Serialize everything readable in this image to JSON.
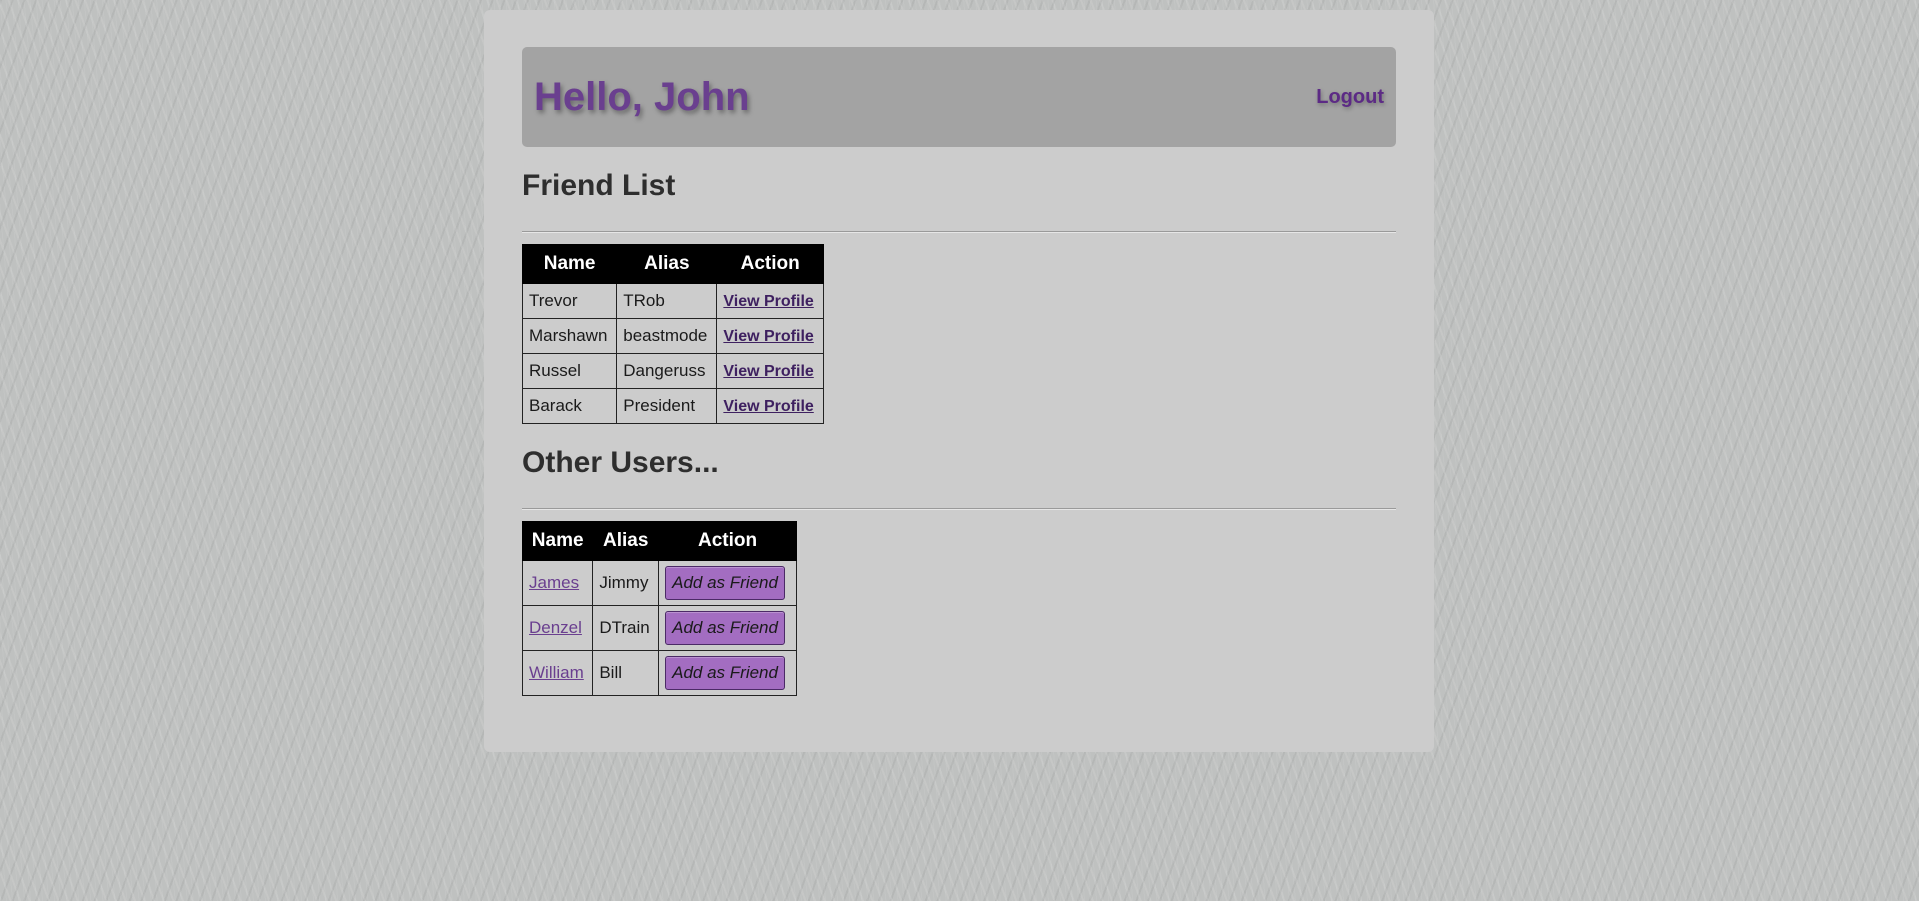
{
  "header": {
    "greeting": "Hello, John",
    "logout_label": "Logout"
  },
  "friends": {
    "title": "Friend List",
    "columns": [
      "Name",
      "Alias",
      "Action"
    ],
    "rows": [
      {
        "name": "Trevor",
        "alias": "TRob",
        "action": "View Profile"
      },
      {
        "name": "Marshawn",
        "alias": "beastmode",
        "action": "View Profile"
      },
      {
        "name": "Russel",
        "alias": "Dangeruss",
        "action": "View Profile"
      },
      {
        "name": "Barack",
        "alias": "President",
        "action": "View Profile"
      }
    ]
  },
  "others": {
    "title": "Other Users...",
    "columns": [
      "Name",
      "Alias",
      "Action"
    ],
    "rows": [
      {
        "name": "James",
        "alias": "Jimmy",
        "action": "Add as Friend"
      },
      {
        "name": "Denzel",
        "alias": "DTrain",
        "action": "Add as Friend"
      },
      {
        "name": "William",
        "alias": "Bill",
        "action": "Add as Friend"
      }
    ]
  },
  "colors": {
    "accent_purple": "#6a3f8f",
    "button_purple": "#a36dc1",
    "header_bg": "#a3a3a3",
    "panel_bg": "#cccccc"
  }
}
